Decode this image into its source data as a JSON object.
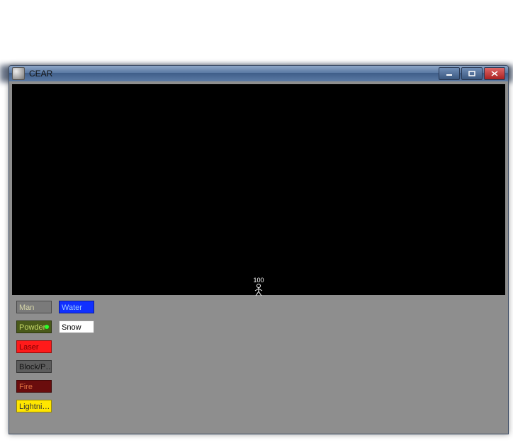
{
  "window": {
    "title": "CEAR"
  },
  "canvas": {
    "hp_value": "100"
  },
  "palette": {
    "rows": [
      {
        "man": "Man",
        "water": "Water"
      },
      {
        "powder": "Powder",
        "snow": "Snow"
      },
      {
        "laser": "Laser"
      },
      {
        "block": "Block/P…"
      },
      {
        "fire": "Fire"
      },
      {
        "light": "Lightni…"
      }
    ]
  },
  "colors": {
    "man": "#7a7a7a",
    "water": "#1030ff",
    "powder": "#4a5a1a",
    "snow": "#ffffff",
    "laser": "#ff1a1a",
    "block": "#5d5d5d",
    "fire": "#6a0d0d",
    "lightning": "#ffe600"
  }
}
